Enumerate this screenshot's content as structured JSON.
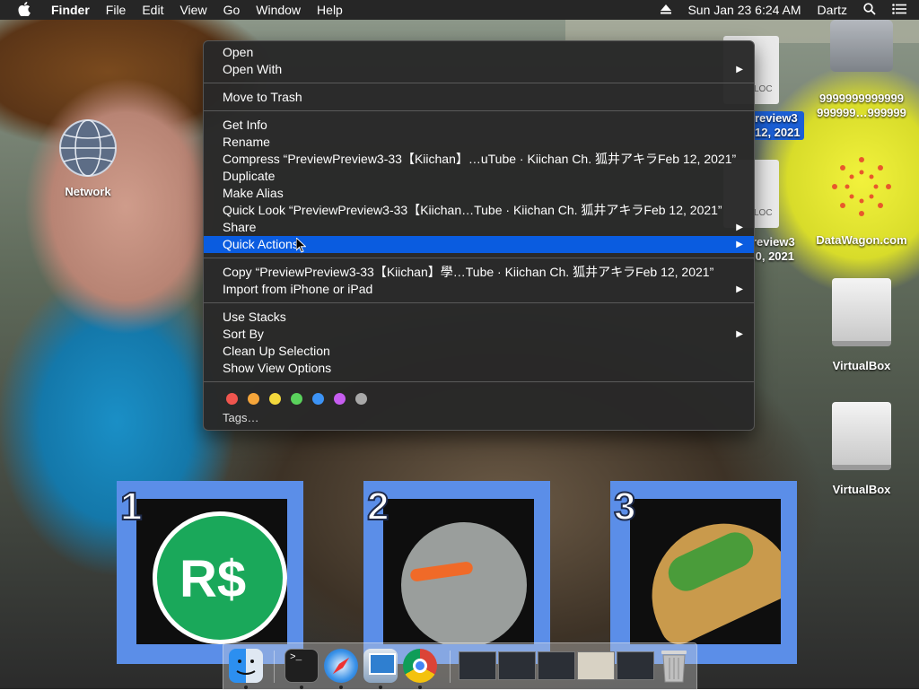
{
  "menubar": {
    "apple": "",
    "app": "Finder",
    "items": [
      "File",
      "Edit",
      "View",
      "Go",
      "Window",
      "Help"
    ],
    "clock": "Sun Jan 23  6:24 AM",
    "user": "Dartz"
  },
  "desktop_icons": {
    "network": "Network",
    "file1_line1": "review3",
    "file1_line2": "12, 2021",
    "file2_line1": "review3",
    "file2_line2": ".0, 2021",
    "disk_label_1": "9999999999999",
    "disk_label_2": "999999…999999",
    "datawagon": "DataWagon.com",
    "virtualbox1": "VirtualBox",
    "virtualbox2": "VirtualBox"
  },
  "wallpaper": {
    "thumb_numbers": [
      "1",
      "2",
      "3"
    ],
    "robux_text": "R$"
  },
  "context_menu": {
    "open": "Open",
    "open_with": "Open With",
    "move_to_trash": "Move to Trash",
    "get_info": "Get Info",
    "rename": "Rename",
    "compress": "Compress “PreviewPreview3-33【Kiichan】…uTube · Kiichan Ch. 狐井アキラFeb 12, 2021”",
    "duplicate": "Duplicate",
    "make_alias": "Make Alias",
    "quick_look": "Quick Look “PreviewPreview3-33【Kiichan…Tube · Kiichan Ch. 狐井アキラFeb 12, 2021”",
    "share": "Share",
    "quick_actions": "Quick Actions",
    "copy": "Copy “PreviewPreview3-33【Kiichan】學…Tube · Kiichan Ch. 狐井アキラFeb 12, 2021”",
    "import_iphone": "Import from iPhone or iPad",
    "use_stacks": "Use Stacks",
    "sort_by": "Sort By",
    "clean_up": "Clean Up Selection",
    "view_options": "Show View Options",
    "tags": "Tags…",
    "tag_colors": [
      "#f0554e",
      "#f5a53a",
      "#f3d83c",
      "#5ad25c",
      "#3c93f5",
      "#c65df0",
      "#a8a8a8"
    ]
  },
  "dock": {
    "apps": [
      "finder-icon",
      "terminal-icon",
      "safari-icon",
      "preview-icon",
      "chrome-icon"
    ]
  },
  "colors": {
    "highlight": "#0a5ce0",
    "menu_bg": "#282828",
    "menubar_bg": "#262626"
  }
}
